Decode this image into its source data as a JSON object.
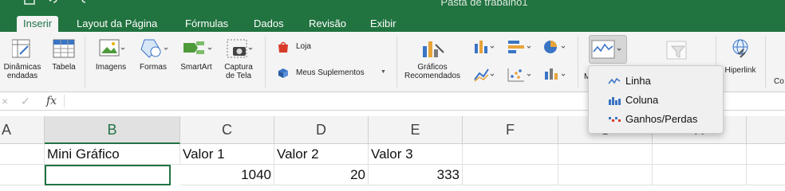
{
  "window": {
    "title": "Pasta de trabalho1"
  },
  "tabs": [
    {
      "label": "Inserir",
      "active": true
    },
    {
      "label": "Layout da Página"
    },
    {
      "label": "Fórmulas"
    },
    {
      "label": "Dados"
    },
    {
      "label": "Revisão"
    },
    {
      "label": "Exibir"
    }
  ],
  "ribbon": {
    "pivot": {
      "line1": "Dinâmicas",
      "line2": "endadas"
    },
    "table": "Tabela",
    "images": "Imagens",
    "shapes": "Formas",
    "smartart": "SmartArt",
    "screenshot": {
      "line1": "Captura",
      "line2": "de Tela"
    },
    "store": "Loja",
    "addins": "Meus Suplementos",
    "recommended_charts": {
      "line1": "Gráficos",
      "line2": "Recomendados"
    },
    "sparkline_partial": "M",
    "hyperlink": "Hiperlink",
    "cut_label": "Co"
  },
  "formula_bar": {
    "fx": "fx",
    "cancel": "×",
    "enter": "✓",
    "value": ""
  },
  "columns": [
    "A",
    "B",
    "C",
    "D",
    "E",
    "F",
    "G",
    "H"
  ],
  "rows": [
    {
      "B": "Mini Gráfico",
      "C": "Valor 1",
      "D": "Valor 2",
      "E": "Valor 3"
    },
    {
      "B": "",
      "C": "1040",
      "D": "20",
      "E": "333"
    }
  ],
  "sparkline_menu": {
    "items": [
      {
        "label": "Linha",
        "icon": "line-sparkline-icon"
      },
      {
        "label": "Coluna",
        "icon": "column-sparkline-icon"
      },
      {
        "label": "Ganhos/Perdas",
        "icon": "winloss-sparkline-icon"
      }
    ]
  },
  "colors": {
    "brand": "#21733f",
    "accent": "#217346",
    "ribbon": "#f4f4f4"
  }
}
